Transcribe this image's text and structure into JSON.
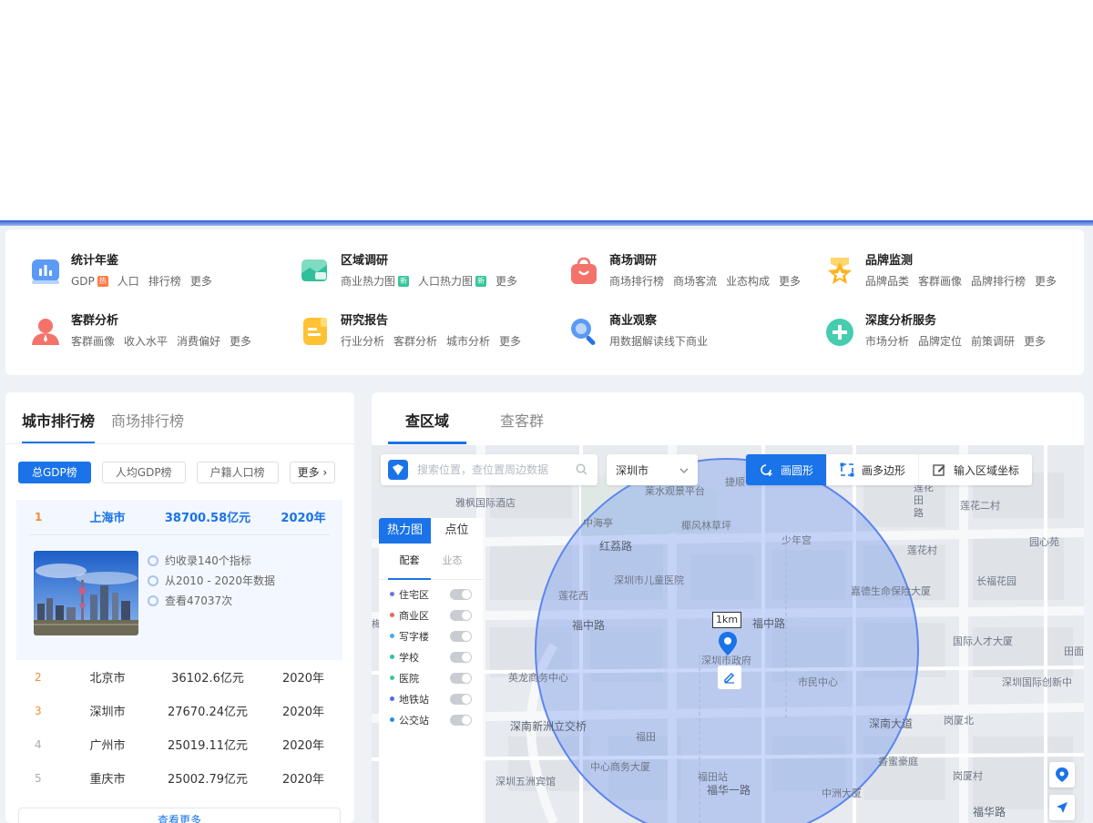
{
  "nav": {
    "items": [
      {
        "title": "统计年鉴",
        "icon": "bar-chart-icon",
        "links": [
          {
            "text": "GDP",
            "badge": "热"
          },
          {
            "text": "人口"
          },
          {
            "text": "排行榜"
          },
          {
            "text": "更多"
          }
        ]
      },
      {
        "title": "区域调研",
        "icon": "map-folder-icon",
        "links": [
          {
            "text": "商业热力图",
            "badge": "新"
          },
          {
            "text": "人口热力图",
            "badge": "新"
          },
          {
            "text": "更多"
          }
        ]
      },
      {
        "title": "商场调研",
        "icon": "shopping-bag-icon",
        "links": [
          {
            "text": "商场排行榜"
          },
          {
            "text": "商场客流"
          },
          {
            "text": "业态构成"
          },
          {
            "text": "更多"
          }
        ]
      },
      {
        "title": "品牌监测",
        "icon": "star-badge-icon",
        "links": [
          {
            "text": "品牌品类"
          },
          {
            "text": "客群画像"
          },
          {
            "text": "品牌排行榜"
          },
          {
            "text": "更多"
          }
        ]
      },
      {
        "title": "客群分析",
        "icon": "user-icon",
        "links": [
          {
            "text": "客群画像"
          },
          {
            "text": "收入水平"
          },
          {
            "text": "消费偏好"
          },
          {
            "text": "更多"
          }
        ]
      },
      {
        "title": "研究报告",
        "icon": "report-icon",
        "links": [
          {
            "text": "行业分析"
          },
          {
            "text": "客群分析"
          },
          {
            "text": "城市分析"
          },
          {
            "text": "更多"
          }
        ]
      },
      {
        "title": "商业观察",
        "icon": "magnifier-icon",
        "links": [
          {
            "text": "用数据解读线下商业"
          }
        ]
      },
      {
        "title": "深度分析服务",
        "icon": "plus-circle-icon",
        "links": [
          {
            "text": "市场分析"
          },
          {
            "text": "品牌定位"
          },
          {
            "text": "前策调研"
          },
          {
            "text": "更多"
          }
        ]
      }
    ]
  },
  "ranking": {
    "tabs": [
      "城市排行榜",
      "商场排行榜"
    ],
    "filters": [
      "总GDP榜",
      "人均GDP榜",
      "户籍人口榜",
      "更多"
    ],
    "rows": [
      {
        "no": "1",
        "city": "上海市",
        "gdp": "38700.58亿元",
        "year": "2020年"
      },
      {
        "no": "2",
        "city": "北京市",
        "gdp": "36102.6亿元",
        "year": "2020年"
      },
      {
        "no": "3",
        "city": "深圳市",
        "gdp": "27670.24亿元",
        "year": "2020年"
      },
      {
        "no": "4",
        "city": "广州市",
        "gdp": "25019.11亿元",
        "year": "2020年"
      },
      {
        "no": "5",
        "city": "重庆市",
        "gdp": "25002.79亿元",
        "year": "2020年"
      }
    ],
    "first_info": [
      "约收录140个指标",
      "从2010 - 2020年数据",
      "查看47037次"
    ],
    "more_label": "查看更多"
  },
  "map": {
    "tabs": [
      "查区域",
      "查客群"
    ],
    "search_placeholder": "搜索位置，查位置周边数据",
    "city": "深圳市",
    "tools": [
      "画圆形",
      "画多边形",
      "输入区域坐标"
    ],
    "layer_tabs": [
      "热力图",
      "点位"
    ],
    "sub_tabs": [
      "配套",
      "业态"
    ],
    "layers": [
      {
        "name": "住宅区",
        "color": "#6b7bd6"
      },
      {
        "name": "商业区",
        "color": "#f0655b"
      },
      {
        "name": "写字楼",
        "color": "#4aa8e8"
      },
      {
        "name": "学校",
        "color": "#2fbfa6"
      },
      {
        "name": "医院",
        "color": "#3cc9a0"
      },
      {
        "name": "地铁站",
        "color": "#4b6fe0"
      },
      {
        "name": "公交站",
        "color": "#2a8de0"
      }
    ],
    "radius_label": "1km",
    "place_labels": [
      "雅枫国际酒店",
      "莱水观景平台",
      "捷顺",
      "中海亭",
      "椰风林草坪",
      "红荔路",
      "少年宫",
      "莲花西",
      "深圳市儿童医院",
      "莲花村",
      "莲花二村",
      "园心苑",
      "福中路",
      "福中路",
      "嘉德生命保险大厦",
      "长福花园",
      "深圳市政府",
      "国际人才大厦",
      "田面",
      "英龙商务中心",
      "市民中心",
      "深圳国际创新中",
      "深南新洲立交桥",
      "深南大道",
      "岗厦北",
      "福田",
      "香蜜豪庭",
      "中心商务大厦",
      "岗厦村",
      "深圳五洲宾馆",
      "福田站",
      "福华一路",
      "中洲大厦",
      "福华路",
      "莲花",
      "田",
      "路",
      "梅"
    ]
  }
}
